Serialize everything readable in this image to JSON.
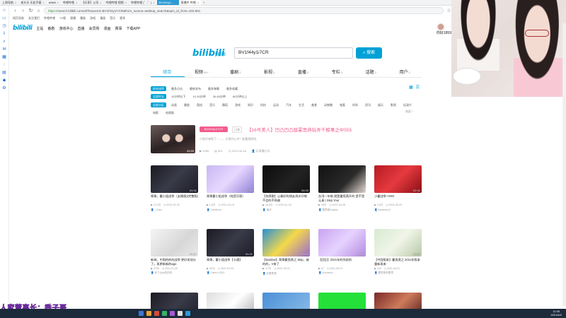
{
  "browser": {
    "tabs": [
      {
        "label": "上网导航"
      },
      {
        "label": "老头乐 乐此不疲"
      },
      {
        "label": "bilibili"
      },
      {
        "label": "哔哩哔哩"
      },
      {
        "label": "【乐享】公司"
      },
      {
        "label": "哔哩哔哩 视频"
      },
      {
        "label": "哔哩哔哩 (゜-゜)"
      },
      {
        "label": "BV1f44y1..."
      },
      {
        "label": "直播中 哔哩"
      }
    ],
    "url_prefix": "https://",
    "url": "search.bilibili.com/all?keyword=BV1f44y1i7CR&from_source=webtop_search&spm_id_from=333.851",
    "bookmarks": [
      "网页导航",
      "关注我们",
      "哔哩哔哩",
      "TV版",
      "直播",
      "番剧",
      "游戏",
      "漫画",
      "音乐",
      "更多"
    ]
  },
  "site_header": {
    "logo": "bilibili",
    "nav": [
      "主站",
      "番剧",
      "游戏中心",
      "直播",
      "会员购",
      "漫画",
      "赛事",
      "下载APP"
    ]
  },
  "user": {
    "name": "你好1859"
  },
  "search": {
    "logo": "bilibili",
    "logo_sub": "| 搜索",
    "query": "BV1f44y1i7CR",
    "button": "搜索"
  },
  "tabs": [
    {
      "label": "综合",
      "count": ""
    },
    {
      "label": "视频",
      "count": "99+"
    },
    {
      "label": "番剧",
      "count": "0"
    },
    {
      "label": "影视",
      "count": "0"
    },
    {
      "label": "直播",
      "count": "0"
    },
    {
      "label": "专栏",
      "count": "0"
    },
    {
      "label": "话题",
      "count": "0"
    },
    {
      "label": "用户",
      "count": "0"
    }
  ],
  "filters": {
    "sort": [
      "综合排序",
      "最多点击",
      "最新发布",
      "最多弹幕",
      "最多收藏"
    ],
    "duration": [
      "全部时长",
      "10分钟以下",
      "10-30分钟",
      "30-60分钟",
      "60分钟以上"
    ],
    "zones": [
      "全部分区",
      "动画",
      "番剧",
      "国创",
      "音乐",
      "舞蹈",
      "游戏",
      "知识",
      "科技",
      "运动",
      "汽车",
      "生活",
      "美食",
      "动物圈",
      "鬼畜",
      "时尚",
      "资讯",
      "娱乐",
      "影视",
      "纪录片",
      "电影",
      "电视剧"
    ],
    "collapse": "收起 ^"
  },
  "featured": {
    "duration": "34:59",
    "tag": "BV1f44y1i7CR",
    "type": "日常",
    "title": "【16号美人】凹凸凹凸版霍思燕玩弄千鲸事之中555",
    "desc": "小鱼仔来啦了~ —— 日常开心中一起看我的吃",
    "meta": [
      "2285",
      "301",
      "2021-05-18",
      "乐享美小乐"
    ]
  },
  "cards": [
    {
      "title": "哥哥，霍小姐战争（友情版)(完整版)",
      "duration": "01:31",
      "views": "10.3万",
      "date": "2021-01-29",
      "up": "_Cabo",
      "bg": "linear-gradient(135deg,#1a1a24,#3a3b48 50%,#1c1d28)"
    },
    {
      "title": "哥哥霍小姐战争（纯音乐版）",
      "duration": "00:59",
      "views": "1.6万",
      "date": "2021-03-15",
      "up": "Cantilena",
      "bg": "linear-gradient(135deg,#c7b7f2,#e8d8ff 50%,#9080d6)"
    },
    {
      "title": "【伤感歌】让最好的朋友再次开唱 不会的不再被",
      "duration": "04:03",
      "views": "48.5万",
      "date": "2019-11-18",
      "up": "潮汐",
      "bg": "linear-gradient(135deg,#0c0c0c,#222 60%,#111)"
    },
    {
      "title": "台湾一年制 就是霍思燕开的 是不是认真 | Skip Your",
      "duration": "04:28",
      "views": "34万",
      "date": "2021-04-28",
      "up": "霍思燕Angela",
      "bg": "linear-gradient(135deg,#111,#2a2a2a 60%,#ece0d8)"
    },
    {
      "title": "小霍战争~VNO",
      "duration": "02:31",
      "views": "2.5万",
      "date": "2021-05-20",
      "up": "Assassin小",
      "bg": "linear-gradient(135deg,#b71a22,#e53a3f 50%,#8a0f14)"
    },
    {
      "title": "新城，中国的的的战争 更好发现分了。再更新新的ago",
      "duration": "01:31",
      "views": "2796",
      "date": "2021-01-29",
      "up": "布丁Qdp的的的",
      "bg": "linear-gradient(135deg,#f4f4f4,#d7d7d7 60%,#e9e9e9)"
    },
    {
      "title": "哥哥，霍小姐战争【卡通】",
      "duration": "01:21",
      "views": "2576",
      "date": "2021-04-30",
      "up": "Cabo小CBO",
      "bg": "linear-gradient(135deg,#1a1a24,#3a3b48 50%,#1c1d28)"
    },
    {
      "title": "【stardew】哥哥霍思燕之 Skip，被的的，V来了",
      "duration": "03:34",
      "views": "3.7万",
      "date": "2021-05-21",
      "up": "在霍思燕",
      "bg": "linear-gradient(135deg,#2a8fd6,#f4d94a 50%,#9a6ad2)"
    },
    {
      "title": "【回忆】2021年的你说的",
      "duration": "01:44",
      "views": "37",
      "date": "2021-05-21",
      "up": "Arrowshs",
      "bg": "linear-gradient(135deg,#c9a3f0,#e6d3ff 50%,#b48ae0)"
    },
    {
      "title": "【中国版本】霍思燕之 2021年版本重新再来",
      "duration": "03:34",
      "views": "134",
      "date": "2021-05-21",
      "up": "霍思燕李霍思",
      "bg": "linear-gradient(135deg,#d8ead0,#f0f5e8 50%,#b7c9a8)"
    },
    {
      "title": "",
      "duration": "",
      "views": "",
      "date": "",
      "up": "",
      "bg": "linear-gradient(135deg,#1a1a24,#3a3b48 50%,#1c1d28)"
    },
    {
      "title": "",
      "duration": "",
      "views": "",
      "date": "",
      "up": "",
      "bg": "linear-gradient(135deg,#ddd,#fff 50%,#aaa)"
    },
    {
      "title": "",
      "duration": "",
      "views": "",
      "date": "",
      "up": "",
      "bg": "linear-gradient(135deg,#4a8fd6,#8fc0ea)"
    },
    {
      "title": "",
      "duration": "",
      "views": "",
      "date": "",
      "up": "",
      "bg": "#24e13a"
    },
    {
      "title": "",
      "duration": "",
      "views": "",
      "date": "",
      "up": "",
      "bg": "linear-gradient(135deg,#7a2a2a,#ce7a5a 50%,#4a1a1a)"
    }
  ],
  "overlay": "人家董事长：香子哥",
  "clock": {
    "time": "11:05",
    "date": "2021/6/2"
  }
}
